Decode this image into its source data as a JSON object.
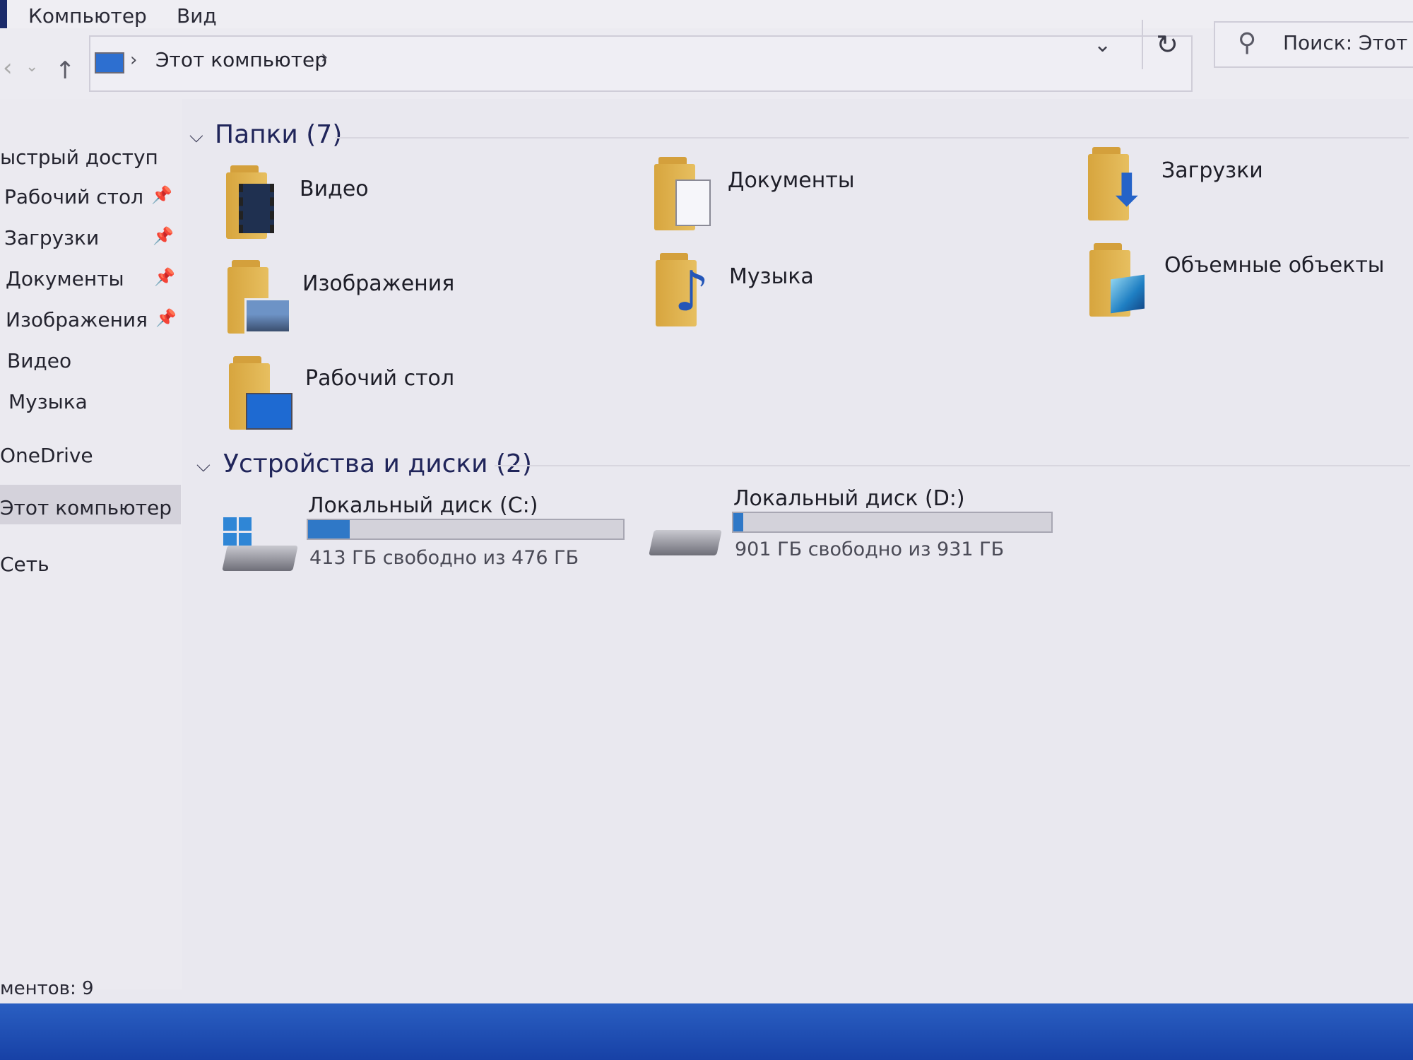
{
  "ribbon": {
    "tabs": [
      "Компьютер",
      "Вид"
    ]
  },
  "address": {
    "path": "Этот компьютер",
    "separator": "›"
  },
  "search": {
    "placeholder": "Поиск: Этот кс"
  },
  "sidebar": {
    "quick_access": "ыстрый доступ",
    "pinned": [
      "Рабочий стол",
      "Загрузки",
      "Документы",
      "Изображения"
    ],
    "unpinned": [
      "Видео",
      "Музыка"
    ],
    "onedrive": "OneDrive",
    "this_pc": "Этот компьютер",
    "network": "Сеть"
  },
  "folders": {
    "header": "Папки (7)",
    "items": [
      "Видео",
      "Документы",
      "Загрузки",
      "Изображения",
      "Музыка",
      "Объемные объекты",
      "Рабочий стол"
    ]
  },
  "drives": {
    "header": "Устройства и диски (2)",
    "items": [
      {
        "name": "Локальный диск (C:)",
        "info": "413 ГБ свободно из 476 ГБ",
        "used_fraction": 0.132
      },
      {
        "name": "Локальный диск (D:)",
        "info": "901 ГБ свободно из 931 ГБ",
        "used_fraction": 0.032
      }
    ]
  },
  "status": {
    "text": "ментов: 9"
  },
  "colors": {
    "accent": "#2f78c7",
    "folder": "#e0b04e",
    "taskbar": "#1f4fb4"
  }
}
